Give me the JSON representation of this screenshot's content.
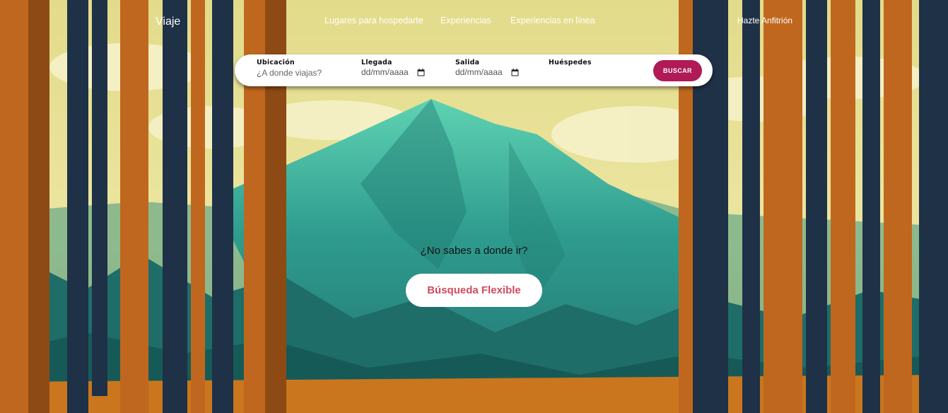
{
  "nav": {
    "brand": "Viaje",
    "links": [
      "Lugares para hospedarte",
      "Experiencias",
      "Experiencias en línea"
    ],
    "host_link": "Hazte Anfitrión"
  },
  "search": {
    "location_label": "Ubicación",
    "location_placeholder": "¿A donde viajas?",
    "checkin_label": "Llegada",
    "checkin_value": "dd/mm/aaaa",
    "checkout_label": "Salida",
    "checkout_value": "dd/mm/aaaa",
    "guests_label": "Huéspedes",
    "button_label": "BUSCAR"
  },
  "hero": {
    "prompt": "¿No sabes a donde ir?",
    "flex_button": "Búsqueda Flexible"
  },
  "colors": {
    "accent": "#b01a55",
    "flex_text": "#d14b5f",
    "sky": "#e6e39a",
    "mountain": "#2f9c8f",
    "trunk": "#c0671f",
    "trunk_dark": "#1e3146"
  }
}
